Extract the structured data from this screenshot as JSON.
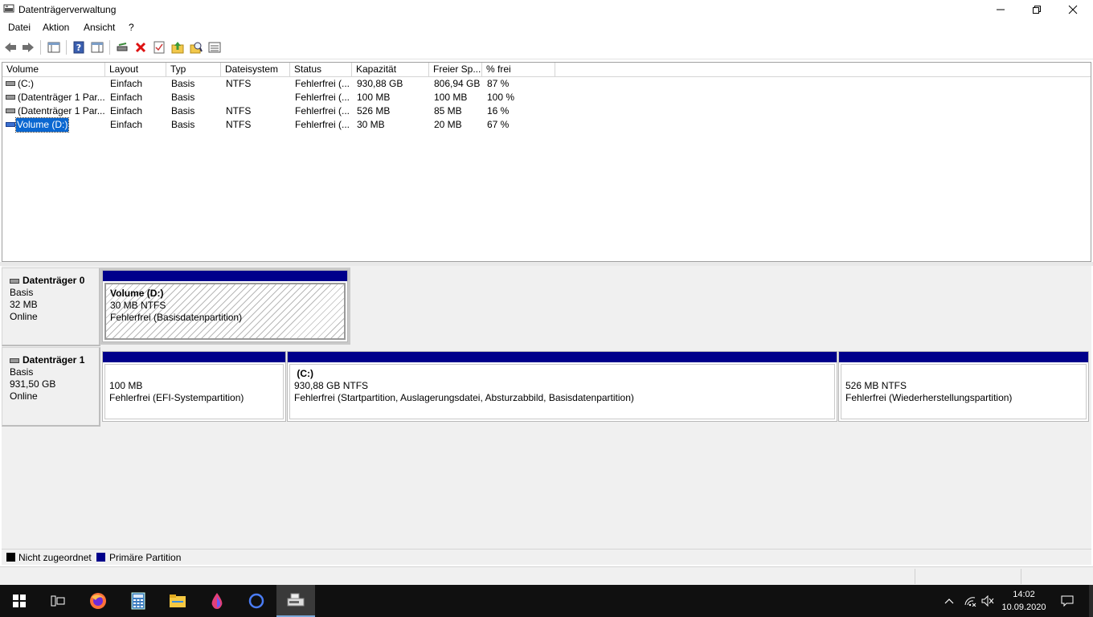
{
  "window": {
    "title": "Datenträgerverwaltung"
  },
  "menu": [
    "Datei",
    "Aktion",
    "Ansicht",
    "?"
  ],
  "toolbar": {
    "icons": [
      "back-arrow-icon",
      "forward-arrow-icon",
      "console-tree-icon",
      "help-icon",
      "show-hide-icon",
      "connect-drive-icon",
      "delete-icon",
      "properties-icon",
      "up-folder-icon",
      "search-icon",
      "list-view-icon"
    ]
  },
  "volume_table": {
    "columns": [
      "Volume",
      "Layout",
      "Typ",
      "Dateisystem",
      "Status",
      "Kapazität",
      "Freier Sp...",
      "% frei"
    ],
    "rows": [
      {
        "volume": " (C:)",
        "layout": "Einfach",
        "typ": "Basis",
        "fs": "NTFS",
        "status": "Fehlerfrei (...",
        "capacity": "930,88 GB",
        "free": "806,94 GB",
        "pct": "87 %"
      },
      {
        "volume": "(Datenträger 1 Par...",
        "layout": "Einfach",
        "typ": "Basis",
        "fs": "",
        "status": "Fehlerfrei (...",
        "capacity": "100 MB",
        "free": "100 MB",
        "pct": "100 %"
      },
      {
        "volume": "(Datenträger 1 Par...",
        "layout": "Einfach",
        "typ": "Basis",
        "fs": "NTFS",
        "status": "Fehlerfrei (...",
        "capacity": "526 MB",
        "free": "85 MB",
        "pct": "16 %"
      },
      {
        "volume": "Volume (D:)",
        "layout": "Einfach",
        "typ": "Basis",
        "fs": "NTFS",
        "status": "Fehlerfrei (...",
        "capacity": "30 MB",
        "free": "20 MB",
        "pct": "67 %"
      }
    ],
    "selected_row": 3
  },
  "disks": [
    {
      "name": "Datenträger 0",
      "type": "Basis",
      "size": "32 MB",
      "state": "Online",
      "partitions": [
        {
          "title": "Volume  (D:)",
          "size": "30 MB NTFS",
          "status": "Fehlerfrei (Basisdatenpartition)",
          "selected": true
        }
      ]
    },
    {
      "name": "Datenträger 1",
      "type": "Basis",
      "size": "931,50 GB",
      "state": "Online",
      "partitions": [
        {
          "title": "",
          "size": "100 MB",
          "status": "Fehlerfrei (EFI-Systempartition)"
        },
        {
          "title": " (C:)",
          "size": "930,88 GB NTFS",
          "status": "Fehlerfrei (Startpartition, Auslagerungsdatei, Absturzabbild, Basisdatenpartition)"
        },
        {
          "title": "",
          "size": "526 MB NTFS",
          "status": "Fehlerfrei (Wiederherstellungspartition)"
        }
      ]
    }
  ],
  "legend": [
    {
      "label": "Nicht zugeordnet",
      "color": "#000000"
    },
    {
      "label": "Primäre Partition",
      "color": "#00008b"
    }
  ],
  "taskbar": {
    "apps": [
      "start-icon",
      "task-view-icon",
      "firefox-icon",
      "calculator-icon",
      "file-explorer-icon",
      "paint-icon",
      "cortana-icon",
      "disk-management-icon"
    ],
    "clock_time": "14:02",
    "clock_date": "10.09.2020"
  },
  "colors": {
    "primary_partition": "#00008b",
    "selection": "#0a67d1",
    "taskbar": "#101010"
  }
}
